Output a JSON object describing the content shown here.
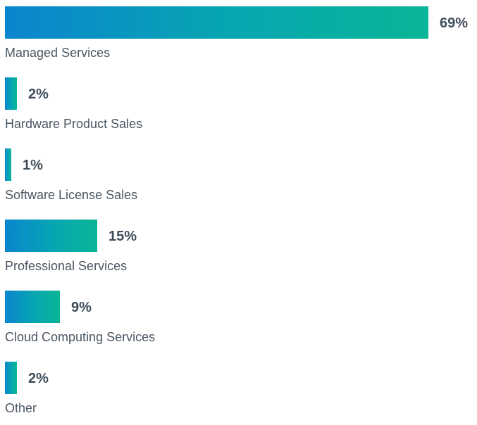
{
  "chart_data": {
    "type": "bar",
    "orientation": "horizontal",
    "categories": [
      "Managed Services",
      "Hardware Product Sales",
      "Software License Sales",
      "Professional Services",
      "Cloud Computing Services",
      "Other"
    ],
    "values": [
      69,
      2,
      1,
      15,
      9,
      2
    ],
    "value_labels": [
      "69%",
      "2%",
      "1%",
      "15%",
      "9%",
      "2%"
    ],
    "unit": "%",
    "title": "",
    "xlabel": "",
    "ylabel": "",
    "xlim": [
      0,
      69
    ],
    "grid": false,
    "legend": "none",
    "colors": {
      "bar_gradient_start": "#0a85cf",
      "bar_gradient_mid": "#07a7b0",
      "bar_gradient_end": "#09b597",
      "value_text": "#3f4c5a",
      "label_text": "#4a5663",
      "background": "#ffffff"
    }
  }
}
